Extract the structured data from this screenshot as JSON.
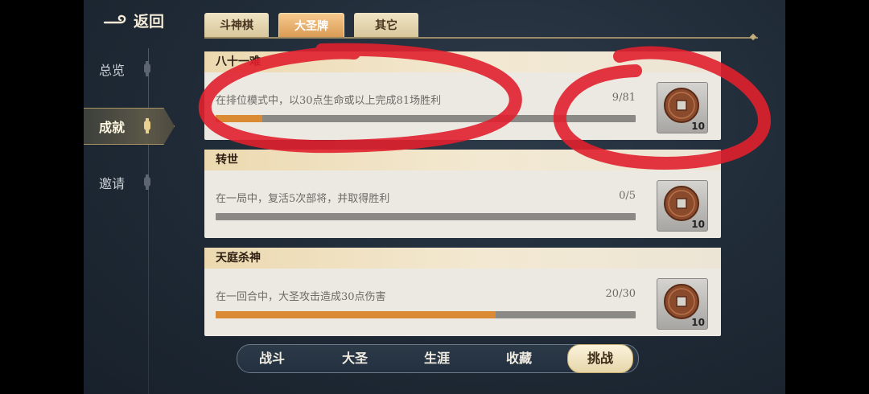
{
  "nav": {
    "back_label": "返回"
  },
  "sidebar": {
    "items": [
      {
        "label": "总览",
        "active": false
      },
      {
        "label": "成就",
        "active": true
      },
      {
        "label": "邀请",
        "active": false
      }
    ]
  },
  "tabs": [
    {
      "label": "斗神棋",
      "active": false
    },
    {
      "label": "大圣牌",
      "active": true
    },
    {
      "label": "其它",
      "active": false
    }
  ],
  "achievements": [
    {
      "title": "八十一难",
      "description": "在排位模式中，以30点生命或以上完成81场胜利",
      "progress_text": "9/81",
      "current": 9,
      "total": 81,
      "reward_count": "10"
    },
    {
      "title": "转世",
      "description": "在一局中，复活5次部将，并取得胜利",
      "progress_text": "0/5",
      "current": 0,
      "total": 5,
      "reward_count": "10"
    },
    {
      "title": "天庭杀神",
      "description": "在一回合中，大圣攻击造成30点伤害",
      "progress_text": "20/30",
      "current": 20,
      "total": 30,
      "reward_count": "10"
    }
  ],
  "bottom_nav": [
    {
      "label": "战斗",
      "active": false
    },
    {
      "label": "大圣",
      "active": false
    },
    {
      "label": "生涯",
      "active": false
    },
    {
      "label": "收藏",
      "active": false
    },
    {
      "label": "挑战",
      "active": true
    }
  ],
  "colors": {
    "progress_fill": "#d98a33",
    "annotation": "#e0202e",
    "tab_active": "#d99a52"
  }
}
